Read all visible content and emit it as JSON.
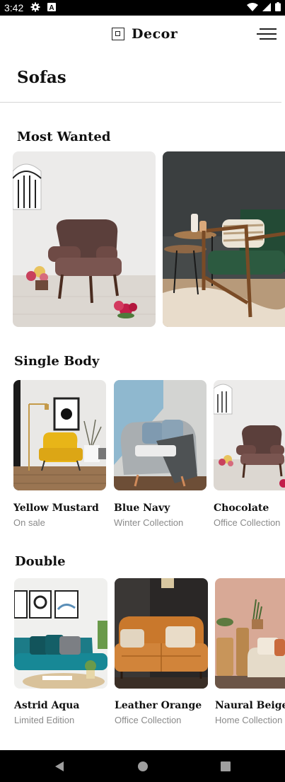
{
  "status_bar": {
    "time": "3:42",
    "icons": [
      "gear-icon",
      "a-notification-icon",
      "wifi-icon",
      "signal-icon",
      "battery-icon"
    ]
  },
  "app_bar": {
    "title": "Decor",
    "logo": "decor-logo-icon",
    "menu_icon": "hamburger-menu-icon"
  },
  "page": {
    "title": "Sofas"
  },
  "most_wanted": {
    "title": "Most Wanted",
    "images": [
      "brown armchair with window and flowers",
      "green armchair with side table"
    ]
  },
  "single_body": {
    "title": "Single Body",
    "items": [
      {
        "name": "Yellow Mustard",
        "subtitle": "On sale"
      },
      {
        "name": "Blue Navy",
        "subtitle": "Winter Collection"
      },
      {
        "name": "Chocolate",
        "subtitle": "Office Collection"
      }
    ]
  },
  "double": {
    "title": "Double",
    "items": [
      {
        "name": "Astrid Aqua",
        "subtitle": "Limited Edition"
      },
      {
        "name": "Leather Orange",
        "subtitle": "Office Collection"
      },
      {
        "name": "Naural Beige",
        "subtitle": "Home Collection"
      }
    ]
  },
  "nav_bar": {
    "icons": [
      "back-icon",
      "home-icon",
      "recents-icon"
    ]
  },
  "colors": {
    "background": "#ffffff",
    "text": "#111111",
    "subtext": "#8a8a8a",
    "divider": "#d6d6d6"
  }
}
